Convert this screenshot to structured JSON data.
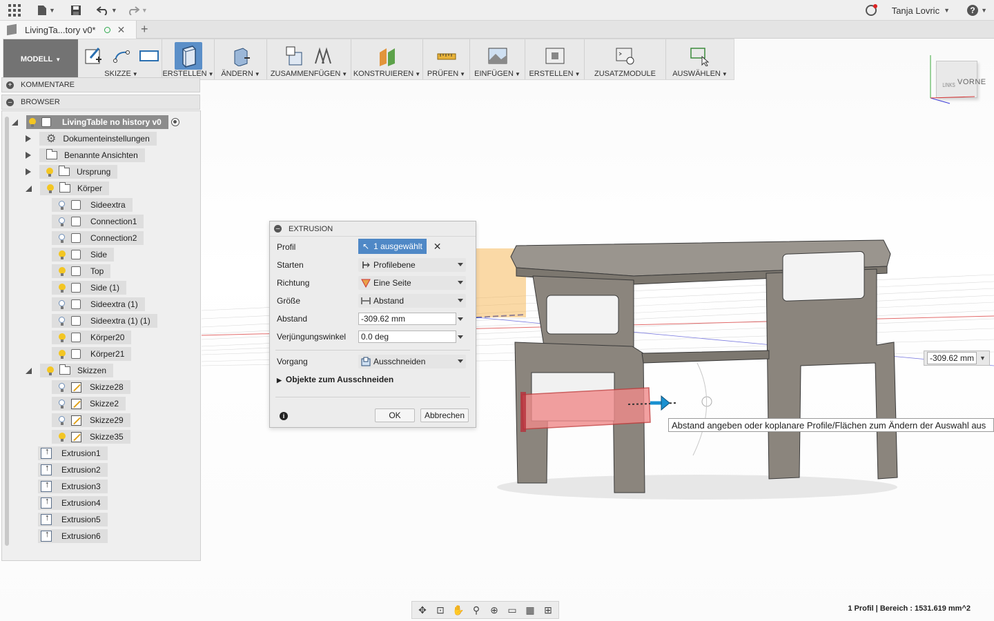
{
  "user": {
    "name": "Tanja Lovric"
  },
  "doc_tab": {
    "title": "LivingTa...tory v0*"
  },
  "toolbar": {
    "mode": "MODELL",
    "groups": [
      "SKIZZE",
      "ERSTELLEN",
      "ÄNDERN",
      "ZUSAMMENFÜGEN",
      "KONSTRUIEREN",
      "PRÜFEN",
      "EINFÜGEN",
      "ERSTELLEN",
      "ZUSATZMODULE",
      "AUSWÄHLEN"
    ]
  },
  "viewcube": {
    "front": "VORNE",
    "left": "LINKS"
  },
  "panels": {
    "comments": "KOMMENTARE",
    "browser": "BROWSER"
  },
  "browser": {
    "root": "LivingTable no history v0",
    "items": [
      "Dokumenteinstellungen",
      "Benannte Ansichten",
      "Ursprung",
      "Körper",
      "Sideextra",
      "Connection1",
      "Connection2",
      "Side",
      "Top",
      "Side (1)",
      "Sideextra (1)",
      "Sideextra (1) (1)",
      "Körper20",
      "Körper21",
      "Skizzen",
      "Skizze28",
      "Skizze2",
      "Skizze29",
      "Skizze35",
      "Extrusion1",
      "Extrusion2",
      "Extrusion3",
      "Extrusion4",
      "Extrusion5",
      "Extrusion6"
    ]
  },
  "extrusion_dialog": {
    "title": "EXTRUSION",
    "labels": {
      "profil": "Profil",
      "starten": "Starten",
      "richtung": "Richtung",
      "groesse": "Größe",
      "abstand": "Abstand",
      "winkel": "Verjüngungswinkel",
      "vorgang": "Vorgang",
      "objekte": "Objekte zum Ausschneiden"
    },
    "values": {
      "profil": "1 ausgewählt",
      "starten": "Profilebene",
      "richtung": "Eine Seite",
      "groesse": "Abstand",
      "abstand": "-309.62 mm",
      "winkel": "0.0 deg",
      "vorgang": "Ausschneiden"
    },
    "ok": "OK",
    "cancel": "Abbrechen"
  },
  "canvas": {
    "dimension": "-309.62 mm",
    "tooltip": "Abstand angeben oder koplanare Profile/Flächen zum Ändern der Auswahl aus"
  },
  "status": "1 Profil | Bereich : 1531.619 mm^2",
  "colors": {
    "accent": "#4f88c6",
    "modell_bg": "#737373",
    "cut_profile": "#f08a8a",
    "table_gray": "#8b857d"
  }
}
